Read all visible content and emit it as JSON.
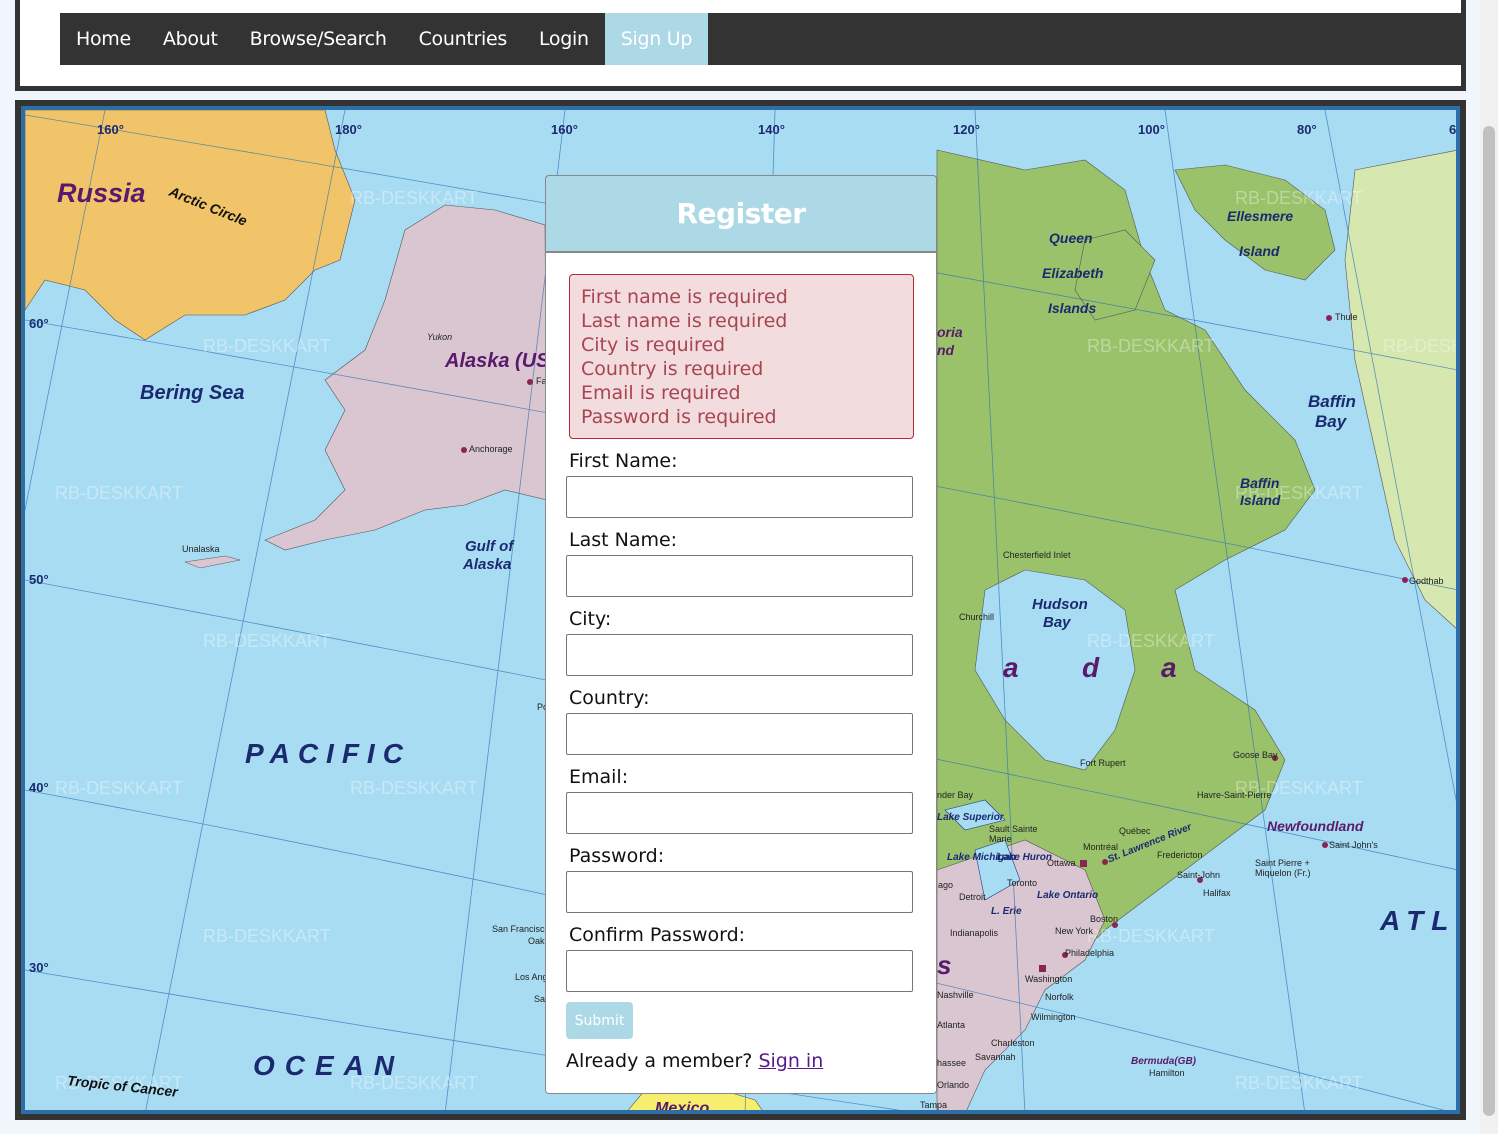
{
  "nav": {
    "items": [
      {
        "label": "Home"
      },
      {
        "label": "About"
      },
      {
        "label": "Browse/Search"
      },
      {
        "label": "Countries"
      },
      {
        "label": "Login"
      },
      {
        "label": "Sign Up",
        "active": true
      }
    ]
  },
  "map": {
    "labels": {
      "russia": "Russia",
      "arctic_circle": "Arctic Circle",
      "alaska": "Alaska (US)",
      "yukon": "Yukon",
      "anchorage": "Anchorage",
      "bering_sea": "Bering Sea",
      "unalaska": "Unalaska",
      "gulf_alaska_1": "Gulf of",
      "gulf_alaska_2": "Alaska",
      "pacific": "PACIFIC",
      "ocean": "OCEAN",
      "tropic": "Tropic of Cancer",
      "queen": "Queen",
      "elizabeth": "Elizabeth",
      "islands": "Islands",
      "ellesmere": "Ellesmere",
      "island": "Island",
      "thule": "Thule",
      "baffin_bay_1": "Baffin",
      "baffin_bay_2": "Bay",
      "baffin_island_1": "Baffin",
      "baffin_island_2": "Island",
      "chesterfield": "Chesterfield Inlet",
      "hudson_1": "Hudson",
      "hudson_2": "Bay",
      "churchill": "Churchill",
      "godthab": "Godthab",
      "canada_a1": "a",
      "canada_d": "d",
      "canada_a2": "a",
      "fort_rupert": "Fort Rupert",
      "goose_bay": "Goose Bay",
      "havre": "Havre-Saint-Pierre",
      "newfoundland": "Newfoundland",
      "st_johns": "Saint John's",
      "saint_pierre": "Saint Pierre + Miquelon (Fr.)",
      "quebec": "Québec",
      "montreal": "Montréal",
      "ottawa": "Ottawa",
      "fredericton": "Fredericton",
      "saint_john": "Saint-John",
      "halifax": "Halifax",
      "st_lawrence": "St. Lawrence River",
      "lake_superior": "Lake Superior",
      "sault": "Sault Sainte Marie",
      "lake_huron": "Lake Huron",
      "lake_michigan": "Lake Michigan",
      "toronto": "Toronto",
      "detroit": "Detroit",
      "lake_erie": "L. Erie",
      "lake_ontario": "Lake Ontario",
      "boston": "Boston",
      "new_york": "New York",
      "philadelphia": "Philadelphia",
      "washington": "Washington",
      "norfolk": "Norfolk",
      "wilmington": "Wilmington",
      "charleston": "Charleston",
      "savannah": "Savannah",
      "atlanta": "Atlanta",
      "nashville": "Nashville",
      "indianapolis": "Indianapolis",
      "orlando": "Orlando",
      "tampa": "Tampa",
      "bermuda": "Bermuda(GB)",
      "hamilton": "Hamilton",
      "atlantic": "ATL",
      "mexico": "Mexico",
      "san_francisco": "San Francisco",
      "los_angeles": "Los Ang",
      "thunder_bay": "nder Bay",
      "victoria": "oria",
      "island_frag": "nd",
      "us_frag": "s",
      "chicago_frag": "ago",
      "oak_frag": "Oak",
      "sa_frag": "Sa",
      "po_frag": "Po",
      "fa_frag": "Fa",
      "tallahassee_frag": "hassee"
    },
    "degrees": {
      "d160w": "160°",
      "d180": "180°",
      "d160e": "160°",
      "d140": "140°",
      "d120": "120°",
      "d100": "100°",
      "d80": "80°",
      "d6": "6",
      "lat60": "60°",
      "lat50": "50°",
      "lat40": "40°",
      "lat30": "30°"
    },
    "watermark": "RB-DESKKART"
  },
  "register": {
    "title": "Register",
    "errors": [
      "First name is required",
      "Last name is required",
      "City is required",
      "Country is required",
      "Email is required",
      "Password is required"
    ],
    "fields": [
      {
        "label": "First Name:",
        "value": ""
      },
      {
        "label": "Last Name:",
        "value": ""
      },
      {
        "label": "City:",
        "value": ""
      },
      {
        "label": "Country:",
        "value": ""
      },
      {
        "label": "Email:",
        "value": ""
      },
      {
        "label": "Password:",
        "value": ""
      },
      {
        "label": "Confirm Password:",
        "value": ""
      }
    ],
    "submit_label": "Submit",
    "member_text": "Already a member?",
    "signin_label": "Sign in"
  },
  "colors": {
    "accent": "#add8e6",
    "nav_bg": "#333333",
    "error_bg": "#f2dcde",
    "error_text": "#a94451",
    "ocean": "#a8dcf3",
    "canada": "#9ac26b",
    "alaska": "#d9c6d0",
    "russia": "#f1c46a"
  }
}
